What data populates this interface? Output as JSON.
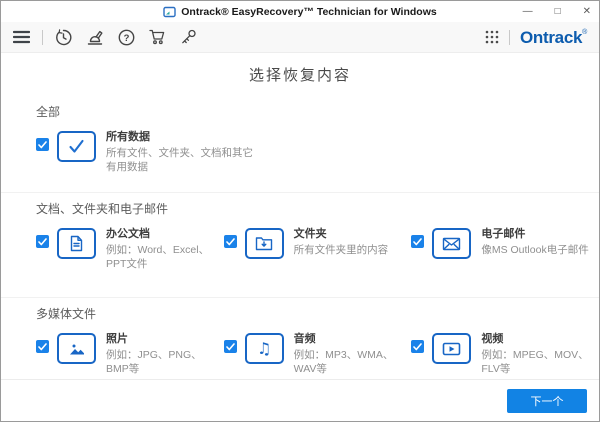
{
  "window": {
    "title": "Ontrack® EasyRecovery™ Technician for Windows",
    "controls": {
      "minimize": "—",
      "maximize": "□",
      "close": "✕"
    }
  },
  "toolbar": {
    "brand": "Ontrack",
    "brand_mark": "®",
    "icons": [
      "menu-icon",
      "history-icon",
      "diagnostics-icon",
      "help-icon",
      "cart-icon",
      "license-key-icon",
      "apps-grid-icon"
    ]
  },
  "page": {
    "title": "选择恢复内容"
  },
  "sections": [
    {
      "heading": "全部",
      "items": [
        {
          "icon": "all-data-check-icon",
          "title": "所有数据",
          "desc": "所有文件、文件夹、文档和其它有用数据",
          "checked": true
        }
      ]
    },
    {
      "heading": "文档、文件夹和电子邮件",
      "items": [
        {
          "icon": "office-document-icon",
          "title": "办公文档",
          "desc": "例如：Word、Excel、PPT文件",
          "checked": true
        },
        {
          "icon": "folder-download-icon",
          "title": "文件夹",
          "desc": "所有文件夹里的内容",
          "checked": true
        },
        {
          "icon": "email-envelope-icon",
          "title": "电子邮件",
          "desc": "像MS Outlook电子邮件",
          "checked": true
        }
      ]
    },
    {
      "heading": "多媒体文件",
      "items": [
        {
          "icon": "photo-icon",
          "title": "照片",
          "desc": "例如：JPG、PNG、BMP等",
          "checked": true
        },
        {
          "icon": "audio-note-icon",
          "title": "音频",
          "desc": "例如：MP3、WMA、WAV等",
          "checked": true
        },
        {
          "icon": "video-play-icon",
          "title": "视频",
          "desc": "例如：MPEG、MOV、FLV等",
          "checked": true
        }
      ]
    }
  ],
  "footer": {
    "next_label": "下一个"
  },
  "colors": {
    "accent_button": "#1283e4",
    "checkbox_blue": "#1a82e9",
    "icon_border_blue": "#1866c5",
    "brand_blue": "#0d5cae",
    "title_text": "#4a4a4a",
    "desc_text": "#8f8f8f"
  },
  "audio_glyph": "♫"
}
